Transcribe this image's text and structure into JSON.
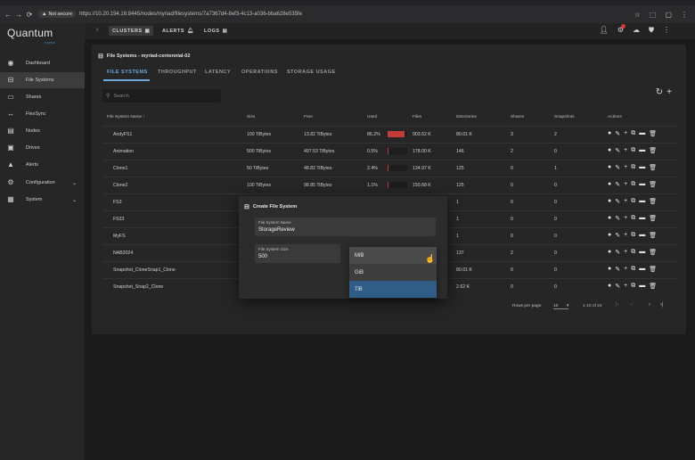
{
  "browser": {
    "security": "Not secure",
    "url": "https://10.20.194.16:8445/nodes/myriad/filesystems/7a7367d4-8ef3-4c13-a036-bba628e535fe"
  },
  "sidebar": {
    "logo": "Quantum",
    "logo_sub": "myriad",
    "items": [
      {
        "label": "Dashboard",
        "icon": "dashboard-icon"
      },
      {
        "label": "File Systems",
        "icon": "file-systems-icon"
      },
      {
        "label": "Shares",
        "icon": "shares-icon"
      },
      {
        "label": "FlexSync",
        "icon": "flexsync-icon"
      },
      {
        "label": "Nodes",
        "icon": "nodes-icon"
      },
      {
        "label": "Drives",
        "icon": "drives-icon"
      },
      {
        "label": "Alerts",
        "icon": "alerts-icon"
      },
      {
        "label": "Configuration",
        "icon": "gear-icon"
      },
      {
        "label": "System",
        "icon": "system-icon"
      }
    ]
  },
  "topbar": {
    "clusters": "CLUSTERS",
    "alerts": "ALERTS",
    "logs": "LOGS"
  },
  "panel": {
    "breadcrumb": "File Systems - myriad-centennial-02",
    "tabs": [
      "FILE SYSTEMS",
      "THROUGHPUT",
      "LATENCY",
      "OPERATIONS",
      "STORAGE USAGE"
    ],
    "search_placeholder": "Search"
  },
  "table": {
    "headers": [
      "File System Name",
      "Size",
      "Free",
      "Used",
      "Files",
      "Directories",
      "Shares",
      "Snapshots",
      "Actions"
    ],
    "rows": [
      {
        "name": "AndyFS1",
        "size": "100 TiBytes",
        "free": "13.82 TiBytes",
        "used": "86.2%",
        "used_frac": 0.862,
        "files": "903.62 K",
        "dirs": "80.01 K",
        "shares": "3",
        "snaps": "2"
      },
      {
        "name": "Animation",
        "size": "500 TiBytes",
        "free": "497.53 TiBytes",
        "used": "0.5%",
        "used_frac": 0.005,
        "files": "178.00 K",
        "dirs": "146",
        "shares": "2",
        "snaps": "0"
      },
      {
        "name": "Clone1",
        "size": "50 TiBytes",
        "free": "48.82 TiBytes",
        "used": "2.4%",
        "used_frac": 0.024,
        "files": "134.97 K",
        "dirs": "125",
        "shares": "0",
        "snaps": "1"
      },
      {
        "name": "Clone2",
        "size": "100 TiBytes",
        "free": "98.85 TiBytes",
        "used": "1.1%",
        "used_frac": 0.011,
        "files": "150.68 K",
        "dirs": "125",
        "shares": "0",
        "snaps": "0"
      },
      {
        "name": "FS3",
        "size": "",
        "free": "",
        "used": "",
        "used_frac": null,
        "files": "",
        "dirs": "1",
        "shares": "0",
        "snaps": "0"
      },
      {
        "name": "FS33",
        "size": "",
        "free": "",
        "used": "",
        "used_frac": null,
        "files": "",
        "dirs": "1",
        "shares": "0",
        "snaps": "0"
      },
      {
        "name": "MyFS",
        "size": "",
        "free": "",
        "used": "",
        "used_frac": null,
        "files": "",
        "dirs": "1",
        "shares": "0",
        "snaps": "0"
      },
      {
        "name": "NAB2024",
        "size": "",
        "free": "",
        "used": "",
        "used_frac": null,
        "files": "",
        "dirs": "137",
        "shares": "2",
        "snaps": "0"
      },
      {
        "name": "Snapshot_CloneSnap1_Clone",
        "size": "",
        "free": "",
        "used": "",
        "used_frac": null,
        "files": "",
        "dirs": "80.01 K",
        "shares": "0",
        "snaps": "0"
      },
      {
        "name": "Snapshot_Snap2_Clone",
        "size": "",
        "free": "",
        "used": "",
        "used_frac": null,
        "files": "",
        "dirs": "2.62 K",
        "shares": "0",
        "snaps": "0"
      }
    ]
  },
  "pager": {
    "rows_label": "Rows per page:",
    "rows_value": "10",
    "range": "1-10 of 24"
  },
  "dialog": {
    "title": "Create File System",
    "name_label": "File System Name",
    "name_value": "StorageReview",
    "size_label": "File System Size",
    "size_value": "500",
    "unit_options": [
      "MiB",
      "GiB",
      "TiB"
    ],
    "unit_selected": "TiB"
  }
}
